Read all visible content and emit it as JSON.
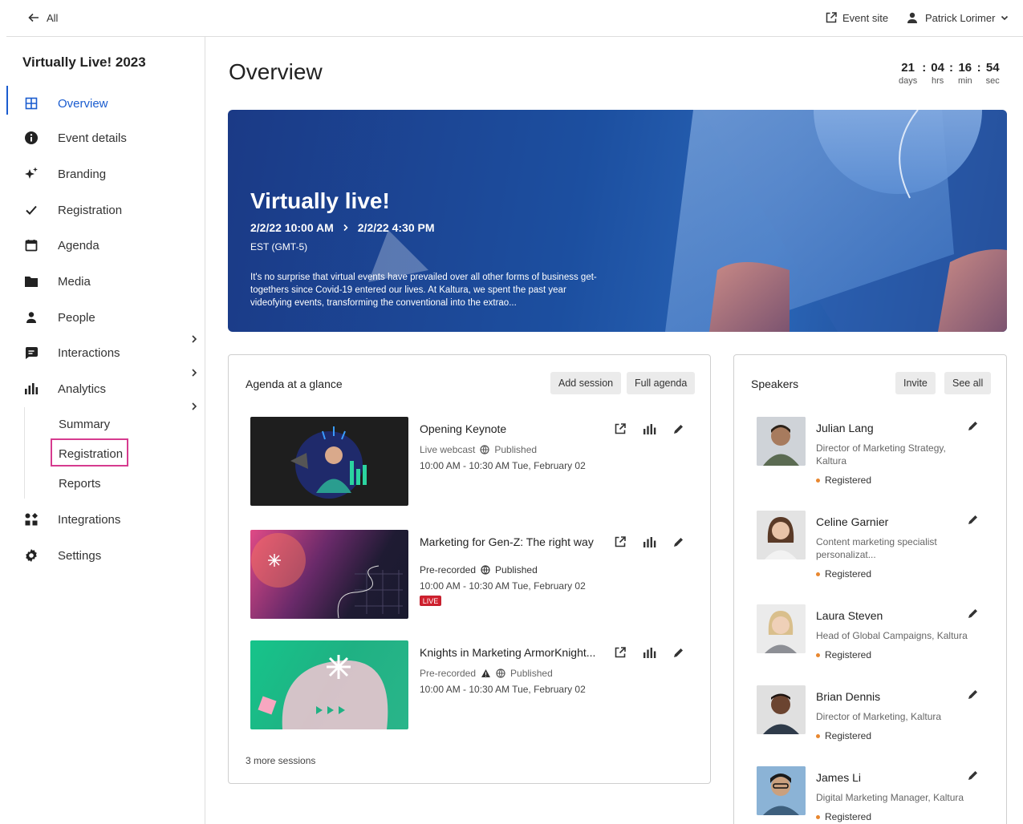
{
  "topbar": {
    "back_label": "All",
    "event_site_label": "Event site",
    "user_name": "Patrick Lorimer"
  },
  "sidebar": {
    "event_title": "Virtually Live! 2023",
    "items": [
      {
        "label": "Overview",
        "icon": "grid-icon",
        "active": true
      },
      {
        "label": "Event details",
        "icon": "info-icon"
      },
      {
        "label": "Branding",
        "icon": "sparkle-icon"
      },
      {
        "label": "Registration",
        "icon": "check-icon"
      },
      {
        "label": "Agenda",
        "icon": "calendar-icon"
      },
      {
        "label": "Media",
        "icon": "folder-icon"
      },
      {
        "label": "People",
        "icon": "person-icon"
      },
      {
        "label": "Interactions",
        "icon": "chat-icon"
      },
      {
        "label": "Analytics",
        "icon": "bar-chart-icon"
      },
      {
        "label": "Integrations",
        "icon": "integrations-icon"
      },
      {
        "label": "Settings",
        "icon": "gear-icon"
      }
    ],
    "analytics_sub": [
      "Summary",
      "Registration",
      "Reports"
    ]
  },
  "main": {
    "title": "Overview",
    "countdown": {
      "days": "21",
      "hrs": "04",
      "min": "16",
      "sec": "54",
      "labels": {
        "days": "days",
        "hrs": "hrs",
        "min": "min",
        "sec": "sec"
      },
      "separator": ":"
    },
    "hero": {
      "title": "Virtually live!",
      "start": "2/2/22 10:00 AM",
      "end": "2/2/22 4:30 PM",
      "timezone": "EST (GMT-5)",
      "description": "It's no surprise that virtual events have prevailed over all other forms of business get-togethers since Covid-19 entered our lives. At Kaltura, we spent the past year videofying events, transforming the conventional into the extrao..."
    }
  },
  "agenda": {
    "title": "Agenda at a glance",
    "add_session": "Add session",
    "full_agenda": "Full agenda",
    "sessions": [
      {
        "title": "Opening Keynote",
        "type": "Live webcast",
        "status": "Published",
        "time": "10:00 AM - 10:30 AM Tue, February 02"
      },
      {
        "title": "Marketing for Gen-Z: The right way",
        "type": "Pre-recorded",
        "status": "Published",
        "time": "10:00 AM - 10:30 AM Tue, February 02",
        "badge": "LIVE"
      },
      {
        "title": "Knights in Marketing ArmorKnight...",
        "type": "Pre-recorded",
        "status": "Published",
        "time": "10:00 AM - 10:30 AM Tue, February 02"
      }
    ],
    "more_sessions": "3 more sessions"
  },
  "speakers": {
    "title": "Speakers",
    "invite": "Invite",
    "see_all": "See all",
    "status_color": "#e8872f",
    "list": [
      {
        "name": "Julian Lang",
        "role": "Director of Marketing Strategy, Kaltura",
        "status": "Registered"
      },
      {
        "name": "Celine Garnier",
        "role": "Content marketing specialist personalizat...",
        "status": "Registered"
      },
      {
        "name": "Laura Steven",
        "role": "Head of Global Campaigns, Kaltura",
        "status": "Registered"
      },
      {
        "name": "Brian Dennis",
        "role": "Director of Marketing, Kaltura",
        "status": "Registered"
      },
      {
        "name": "James Li",
        "role": "Digital Marketing Manager, Kaltura",
        "status": "Registered"
      }
    ]
  },
  "colors": {
    "accent": "#1a5ccf",
    "highlight_box": "#d63b8f",
    "live": "#d0202e"
  }
}
